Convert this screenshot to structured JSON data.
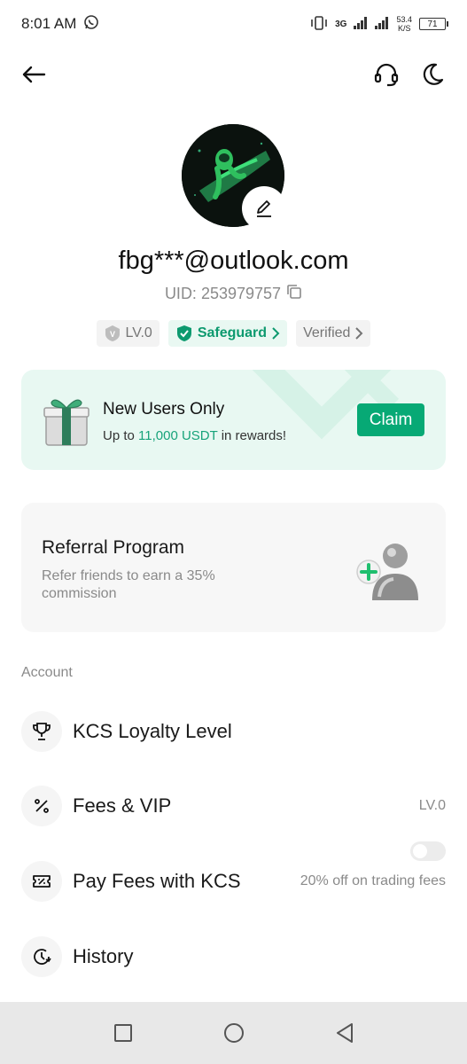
{
  "status_bar": {
    "time": "8:01 AM",
    "network": "3G",
    "speed_value": "53.4",
    "speed_unit": "K/S",
    "battery": "71"
  },
  "profile": {
    "email": "fbg***@outlook.com",
    "uid": "UID: 253979757"
  },
  "badges": {
    "level": "LV.0",
    "safeguard": "Safeguard",
    "verified": "Verified"
  },
  "promo": {
    "title": "New Users Only",
    "sub_prefix": "Up to ",
    "sub_highlight": "11,000 USDT",
    "sub_suffix": " in rewards!",
    "claim_label": "Claim"
  },
  "referral": {
    "title": "Referral Program",
    "description": "Refer friends to earn a 35% commission"
  },
  "account": {
    "section_label": "Account",
    "items": [
      {
        "label": "KCS Loyalty Level",
        "icon": "trophy-icon"
      },
      {
        "label": "Fees & VIP",
        "icon": "percent-icon",
        "value": "LV.0"
      },
      {
        "label": "Pay Fees with KCS",
        "icon": "ticket-icon",
        "note": "20% off on trading fees",
        "enabled": false
      },
      {
        "label": "History",
        "icon": "history-icon"
      }
    ]
  },
  "colors": {
    "accent": "#07a975",
    "promo_bg": "#e8f8f2",
    "card_bg": "#f7f7f7"
  }
}
